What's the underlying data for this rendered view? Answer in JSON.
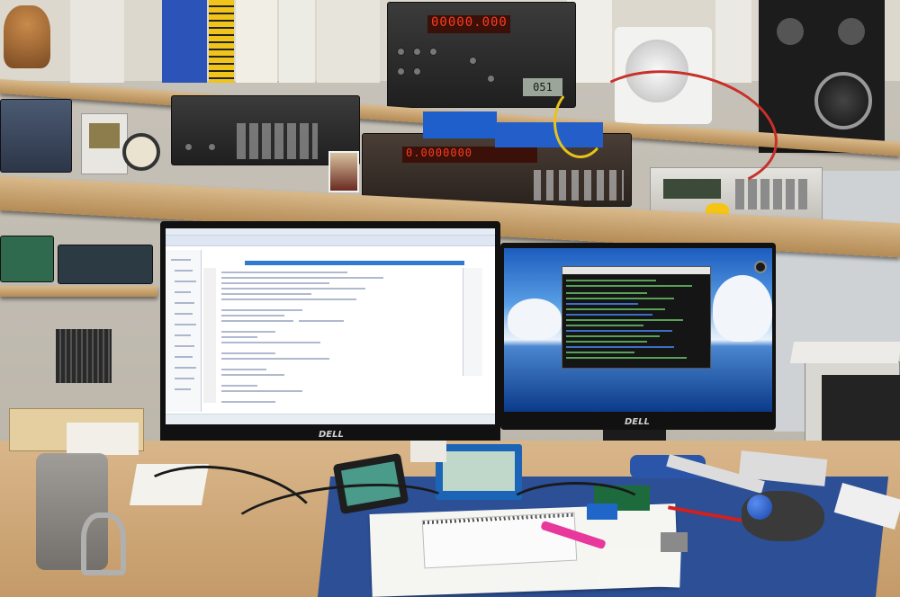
{
  "scene": {
    "description_labels": {
      "monitor_left_brand": "DELL",
      "monitor_right_brand": "DELL",
      "led_display_top": "00000.000",
      "lcd_right": "051",
      "led_middle": "0.0000000"
    }
  },
  "colors": {
    "shelf": "#c9a06b",
    "mat": "#2c4f95",
    "desk": "#d2ab7a",
    "terminal_text": "#6fd06f",
    "led_red": "#ff3b20"
  },
  "icons": [
    "trackball-icon",
    "binder-icon",
    "oscilloscope-icon",
    "multimeter-icon",
    "soldering-station-icon",
    "speaker-icon",
    "notebook-icon"
  ]
}
